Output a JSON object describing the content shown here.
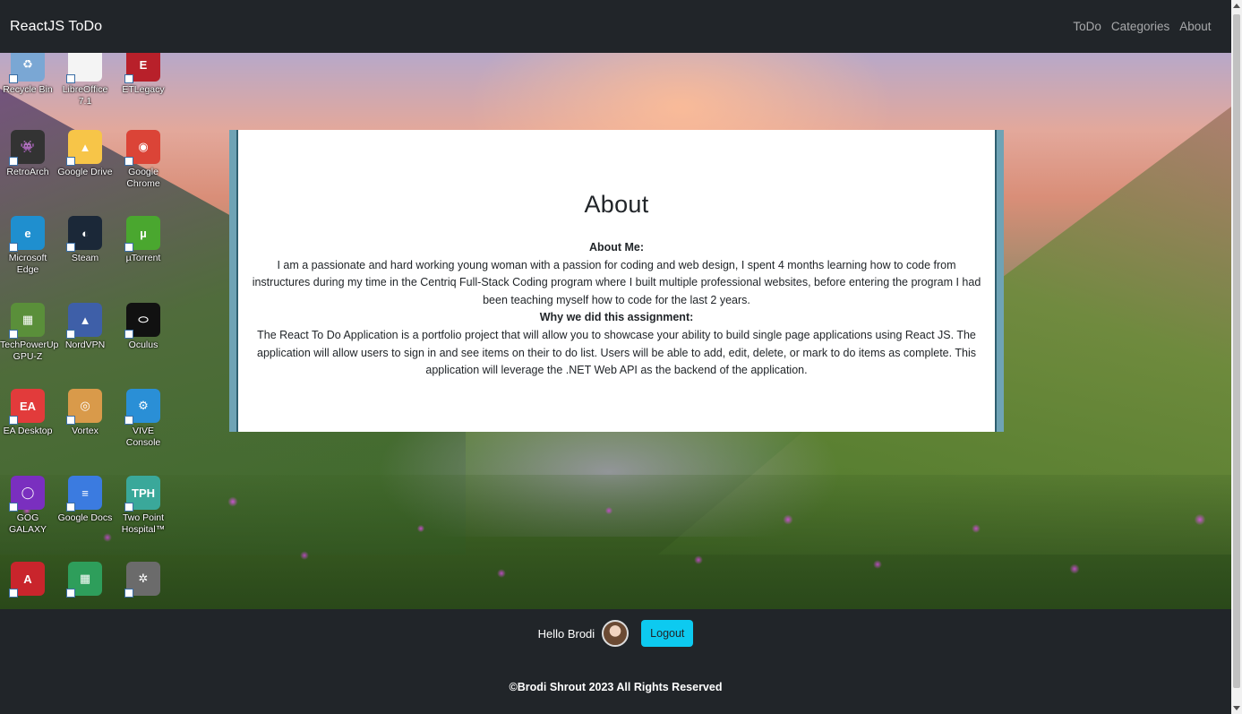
{
  "navbar": {
    "brand": "ReactJS ToDo",
    "links": [
      "ToDo",
      "Categories",
      "About"
    ]
  },
  "desktop_icons": [
    {
      "label": "Recycle Bin",
      "icon": "recycle-bin-icon",
      "color": "#7aa7d4",
      "glyph": "♻"
    },
    {
      "label": "LibreOffice 7.1",
      "icon": "libreoffice-icon",
      "color": "#f4f4f4",
      "glyph": ""
    },
    {
      "label": "ETLegacy",
      "icon": "etlegacy-icon",
      "color": "#b8202a",
      "glyph": "E"
    },
    {
      "label": "RetroArch",
      "icon": "retroarch-icon",
      "color": "#333333",
      "glyph": "👾"
    },
    {
      "label": "Google Drive",
      "icon": "google-drive-icon",
      "color": "#f7c548",
      "glyph": "▲"
    },
    {
      "label": "Google Chrome",
      "icon": "chrome-icon",
      "color": "#db4437",
      "glyph": "◉"
    },
    {
      "label": "Microsoft Edge",
      "icon": "edge-icon",
      "color": "#1f8fcf",
      "glyph": "e"
    },
    {
      "label": "Steam",
      "icon": "steam-icon",
      "color": "#1b2838",
      "glyph": "◐"
    },
    {
      "label": "µTorrent",
      "icon": "utorrent-icon",
      "color": "#4aa72f",
      "glyph": "µ"
    },
    {
      "label": "TechPowerUp GPU-Z",
      "icon": "gpu-z-icon",
      "color": "#5a8f3a",
      "glyph": "▦"
    },
    {
      "label": "NordVPN",
      "icon": "nordvpn-icon",
      "color": "#3e5fa8",
      "glyph": "▲"
    },
    {
      "label": "Oculus",
      "icon": "oculus-icon",
      "color": "#111111",
      "glyph": "⬭"
    },
    {
      "label": "EA Desktop",
      "icon": "ea-desktop-icon",
      "color": "#e23b3b",
      "glyph": "EA"
    },
    {
      "label": "Vortex",
      "icon": "vortex-icon",
      "color": "#d99a4a",
      "glyph": "◎"
    },
    {
      "label": "VIVE Console",
      "icon": "vive-console-icon",
      "color": "#2a8fd6",
      "glyph": "⚙"
    },
    {
      "label": "GOG GALAXY",
      "icon": "gog-galaxy-icon",
      "color": "#7a2fbf",
      "glyph": "◯"
    },
    {
      "label": "Google Docs",
      "icon": "google-docs-icon",
      "color": "#3b7be0",
      "glyph": "≡"
    },
    {
      "label": "Two Point Hospital™",
      "icon": "two-point-hospital-icon",
      "color": "#3aa89a",
      "glyph": "TPH"
    },
    {
      "label": "",
      "icon": "acrobat-icon",
      "color": "#c9252c",
      "glyph": "A"
    },
    {
      "label": "",
      "icon": "google-sheets-icon",
      "color": "#2e9e5b",
      "glyph": "▦"
    },
    {
      "label": "",
      "icon": "aperture-icon",
      "color": "#6b6b6b",
      "glyph": "✲"
    }
  ],
  "about": {
    "title": "About",
    "about_me_heading": "About Me:",
    "about_me_text": "I am a passionate and hard working young woman with a passion for coding and web design, I spent 4 months learning how to code from instructures during my time in the Centriq Full-Stack Coding program where I built multiple professional websites, before entering the program I had been teaching myself how to code for the last 2 years.",
    "why_heading": "Why we did this assignment:",
    "why_text": "The React To Do Application is a portfolio project that will allow you to showcase your ability to build single page applications using React JS. The application will allow users to sign in and see items on their to do list. Users will be able to add, edit, delete, or mark to do items as complete. This application will leverage the .NET Web API as the backend of the application."
  },
  "footer": {
    "greeting": "Hello Brodi",
    "logout_label": "Logout",
    "copyright": "©Brodi Shrout 2023 All Rights Reserved"
  },
  "colors": {
    "navbar_bg": "#212529",
    "logout_bg": "#0dcaf0",
    "card_border": "#6fa3b5"
  }
}
